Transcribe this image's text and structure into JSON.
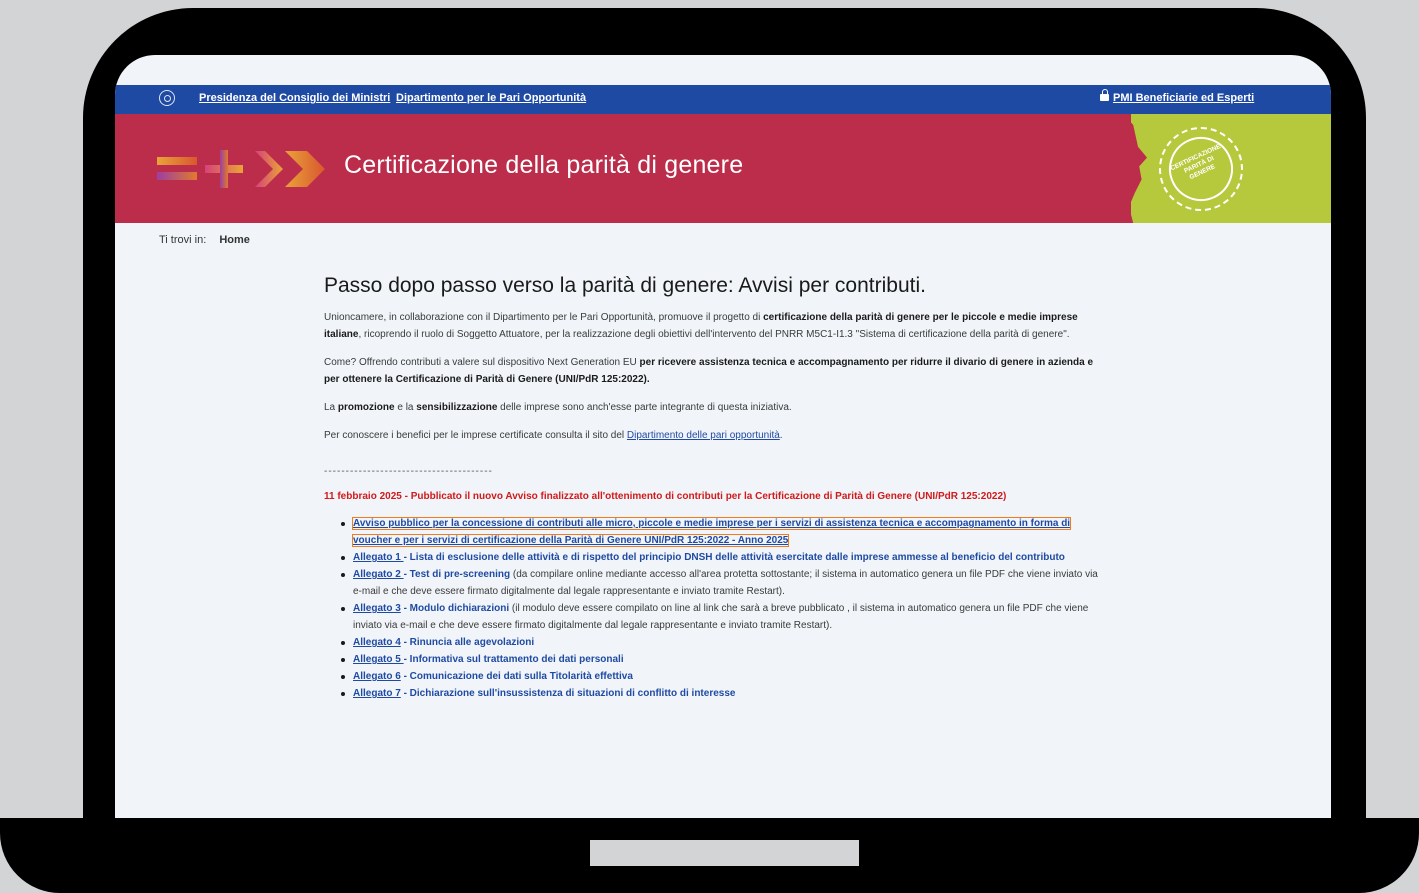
{
  "topbar": {
    "link1": "Presidenza del Consiglio dei Ministri",
    "link2": "Dipartimento per le Pari Opportunità",
    "pmi_link": "PMI Beneficiarie ed Esperti"
  },
  "banner": {
    "title": "Certificazione della parità di genere",
    "seal_text": "CERTIFICAZIONE PARITÀ DI GENERE"
  },
  "breadcrumb": {
    "label": "Ti trovi in:",
    "current": "Home"
  },
  "main": {
    "heading": "Passo dopo passo verso la parità di genere: Avvisi per contributi.",
    "p1_a": "Unioncamere, in collaborazione con il Dipartimento per le Pari Opportunità, promuove il progetto di ",
    "p1_b": "certificazione della parità di genere per le piccole e medie imprese italiane",
    "p1_c": ", ricoprendo il ruolo di Soggetto Attuatore, per la realizzazione degli obiettivi dell'intervento del PNRR M5C1-I1.3 \"Sistema di certificazione della parità di genere\".",
    "p2_a": "Come? Offrendo contributi a valere sul dispositivo Next Generation EU ",
    "p2_b": "per ricevere assistenza tecnica e accompagnamento per ridurre il divario di genere in azienda e per ottenere la Certificazione di Parità di Genere (UNI/PdR 125:2022).",
    "p3_a": "La ",
    "p3_b": "promozione",
    "p3_c": " e la ",
    "p3_d": "sensibilizzazione",
    "p3_e": " delle imprese sono anch'esse parte integrante di questa iniziativa.",
    "p4_a": "Per conoscere i benefici per le imprese certificate consulta il sito del ",
    "p4_link": "Dipartimento delle pari opportunità",
    "p4_end": ".",
    "dashes": "---------------------------------------",
    "notice": "11 febbraio 2025 - Pubblicato il nuovo Avviso finalizzato all'ottenimento di contributi per la Certificazione di Parità di Genere (UNI/PdR 125:2022)",
    "docs": [
      {
        "link": "Avviso pubblico per la concessione di contributi alle micro, piccole e medie imprese per i servizi di assistenza tecnica e accompagnamento in forma di voucher e per i servizi di certificazione della Parità di Genere UNI/PdR 125:2022 - Anno 2025"
      },
      {
        "link": "Allegato 1 ",
        "title": "- Lista di esclusione delle attività e di rispetto del principio DNSH delle attività esercitate dalle imprese ammesse al beneficio del contributo"
      },
      {
        "link": "Allegato 2 ",
        "title": "- Test di pre-screening",
        "desc": " (da compilare online mediante accesso all'area protetta sottostante; il sistema in automatico genera un file PDF che viene inviato via e-mail e che deve essere firmato digitalmente dal legale rappresentante e inviato tramite Restart)."
      },
      {
        "link": "Allegato 3",
        "title": " - Modulo dichiarazioni",
        "desc": " (il modulo deve essere compilato on line al link che sarà a breve pubblicato , il sistema in automatico genera un file PDF che viene inviato via e-mail e che deve essere firmato digitalmente dal legale rappresentante e inviato tramite Restart)."
      },
      {
        "link": "Allegato 4",
        "title": " - Rinuncia alle agevolazioni"
      },
      {
        "link": "Allegato 5 ",
        "title": "- Informativa sul trattamento dei dati personali"
      },
      {
        "link": "Allegato 6",
        "title": " - Comunicazione dei dati sulla Titolarità effettiva"
      },
      {
        "link": "Allegato 7",
        "title": " - Dichiarazione sull'insussistenza di situazioni di conflitto di interesse"
      }
    ]
  },
  "colors": {
    "topbar": "#1f4aa3",
    "banner": "#bb2d4a",
    "accent_green": "#b6c83c",
    "notice": "#d11a1a",
    "highlight": "#f07c1b"
  }
}
